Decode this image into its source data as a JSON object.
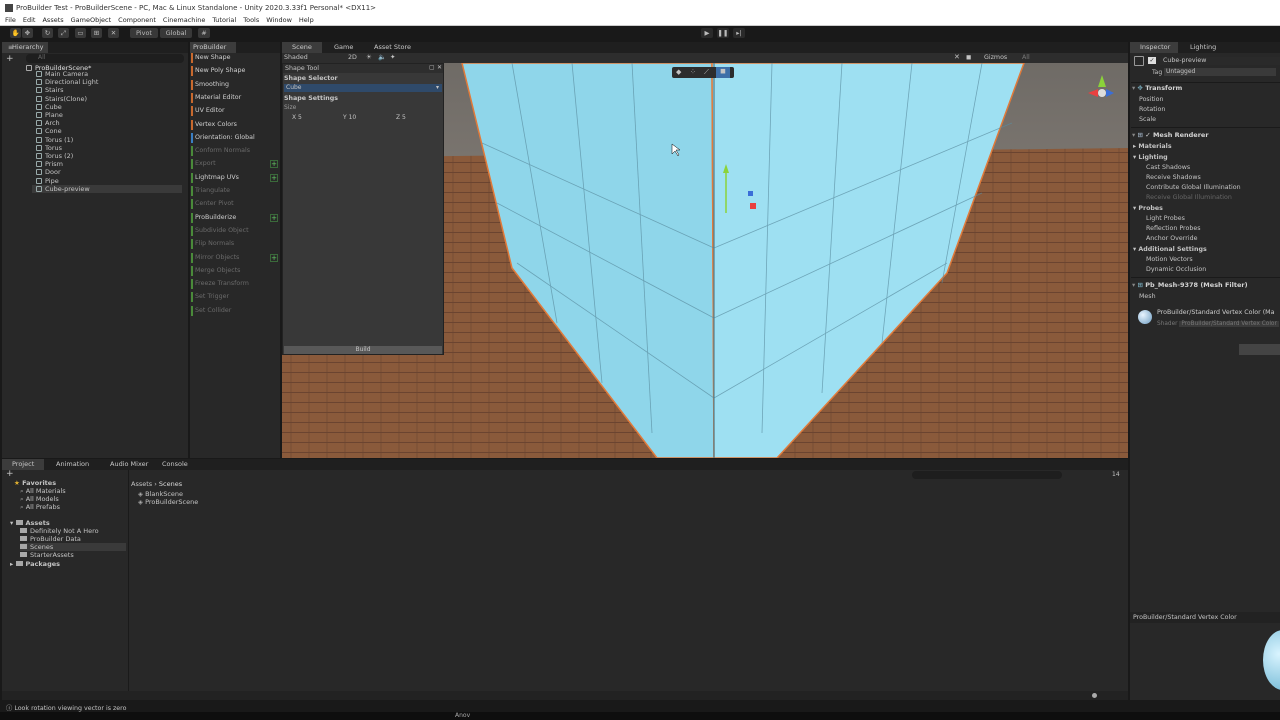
{
  "window": {
    "title": "ProBuilder Test - ProBuilderScene - PC, Mac & Linux Standalone - Unity 2020.3.33f1 Personal* <DX11>"
  },
  "menu": [
    "File",
    "Edit",
    "Assets",
    "GameObject",
    "Component",
    "Cinemachine",
    "Tutorial",
    "Tools",
    "Window",
    "Help"
  ],
  "toolbar": {
    "pivot": "Pivot",
    "global": "Global"
  },
  "hierarchy": {
    "tab": "Hierarchy",
    "search_placeholder": "All",
    "scene": "ProBuilderScene*",
    "items": [
      "Main Camera",
      "Directional Light",
      "Stairs",
      "Stairs(Clone)",
      "Cube",
      "Plane",
      "Arch",
      "Cone",
      "Torus (1)",
      "Torus",
      "Torus (2)",
      "Prism",
      "Door",
      "Pipe",
      "Cube-preview"
    ]
  },
  "probuilder": {
    "tab": "ProBuilder",
    "buttons": [
      {
        "label": "New Shape",
        "color": "#c8692e",
        "enabled": true,
        "plus": false
      },
      {
        "label": "New Poly Shape",
        "color": "#c8692e",
        "enabled": true,
        "plus": false
      },
      {
        "label": "Smoothing",
        "color": "#c8692e",
        "enabled": true,
        "plus": false
      },
      {
        "label": "Material Editor",
        "color": "#c8692e",
        "enabled": true,
        "plus": false
      },
      {
        "label": "UV Editor",
        "color": "#c8692e",
        "enabled": true,
        "plus": false
      },
      {
        "label": "Vertex Colors",
        "color": "#c8692e",
        "enabled": true,
        "plus": false
      },
      {
        "label": "Orientation: Global",
        "color": "#3a7fc4",
        "enabled": true,
        "plus": false
      },
      {
        "label": "Conform Normals",
        "color": "#4a8a3a",
        "enabled": false,
        "plus": false
      },
      {
        "label": "Export",
        "color": "#4a8a3a",
        "enabled": false,
        "plus": true
      },
      {
        "label": "Lightmap UVs",
        "color": "#4a8a3a",
        "enabled": true,
        "plus": true
      },
      {
        "label": "Triangulate",
        "color": "#4a8a3a",
        "enabled": false,
        "plus": false
      },
      {
        "label": "Center Pivot",
        "color": "#4a8a3a",
        "enabled": false,
        "plus": false
      },
      {
        "label": "ProBuilderize",
        "color": "#4a8a3a",
        "enabled": true,
        "plus": true
      },
      {
        "label": "Subdivide Object",
        "color": "#4a8a3a",
        "enabled": false,
        "plus": false
      },
      {
        "label": "Flip Normals",
        "color": "#4a8a3a",
        "enabled": false,
        "plus": false
      },
      {
        "label": "Mirror Objects",
        "color": "#4a8a3a",
        "enabled": false,
        "plus": true
      },
      {
        "label": "Merge Objects",
        "color": "#4a8a3a",
        "enabled": false,
        "plus": false
      },
      {
        "label": "Freeze Transform",
        "color": "#4a8a3a",
        "enabled": false,
        "plus": false
      },
      {
        "label": "Set Trigger",
        "color": "#4a8a3a",
        "enabled": false,
        "plus": false
      },
      {
        "label": "Set Collider",
        "color": "#4a8a3a",
        "enabled": false,
        "plus": false
      }
    ]
  },
  "scene": {
    "tabs": [
      "Scene",
      "Game",
      "Asset Store"
    ],
    "shading": "Shaded",
    "mode2d": "2D",
    "gizmos": "Gizmos",
    "search_placeholder": "All"
  },
  "shape_tool": {
    "title": "Shape Tool",
    "selector_label": "Shape Selector",
    "selected_shape": "Cube",
    "settings_label": "Shape Settings",
    "size_label": "Size",
    "x_label": "X",
    "x_value": "5",
    "y_label": "Y",
    "y_value": "10",
    "z_label": "Z",
    "z_value": "5",
    "build": "Build"
  },
  "inspector": {
    "tabs": [
      "Inspector",
      "Lighting"
    ],
    "object_name": "Cube-preview",
    "tag_label": "Tag",
    "tag_value": "Untagged",
    "transform": "Transform",
    "position": "Position",
    "rotation": "Rotation",
    "scale": "Scale",
    "mesh_renderer": "Mesh Renderer",
    "materials": "Materials",
    "lighting": "Lighting",
    "cast_shadows": "Cast Shadows",
    "receive_shadows": "Receive Shadows",
    "contribute_gi": "Contribute Global Illumination",
    "receive_gi": "Receive Global Illumination",
    "probes": "Probes",
    "light_probes": "Light Probes",
    "reflection_probes": "Reflection Probes",
    "anchor_override": "Anchor Override",
    "additional_settings": "Additional Settings",
    "motion_vectors": "Motion Vectors",
    "dynamic_occlusion": "Dynamic Occlusion",
    "mesh_filter": "Pb_Mesh-9378 (Mesh Filter)",
    "mesh": "Mesh",
    "material_name": "ProBuilder/Standard Vertex Color (Ma",
    "shader_label": "Shader",
    "shader_value": "ProBuilder/Standard Vertex Color",
    "preview_label": "ProBuilder/Standard Vertex Color"
  },
  "project": {
    "tabs": [
      "Project",
      "Animation",
      "Audio Mixer",
      "Console"
    ],
    "favorites": "Favorites",
    "favorite_items": [
      "All Materials",
      "All Models",
      "All Prefabs"
    ],
    "assets": "Assets",
    "asset_folders": [
      "Definitely Not A Hero",
      "ProBuilder Data",
      "Scenes",
      "StarterAssets"
    ],
    "packages": "Packages",
    "breadcrumb": [
      "Assets",
      "Scenes"
    ],
    "files": [
      "BlankScene",
      "ProBuilderScene"
    ],
    "count_badge": "14"
  },
  "status": {
    "message": "Look rotation viewing vector is zero"
  },
  "taskbar": {
    "label": "Anov"
  }
}
